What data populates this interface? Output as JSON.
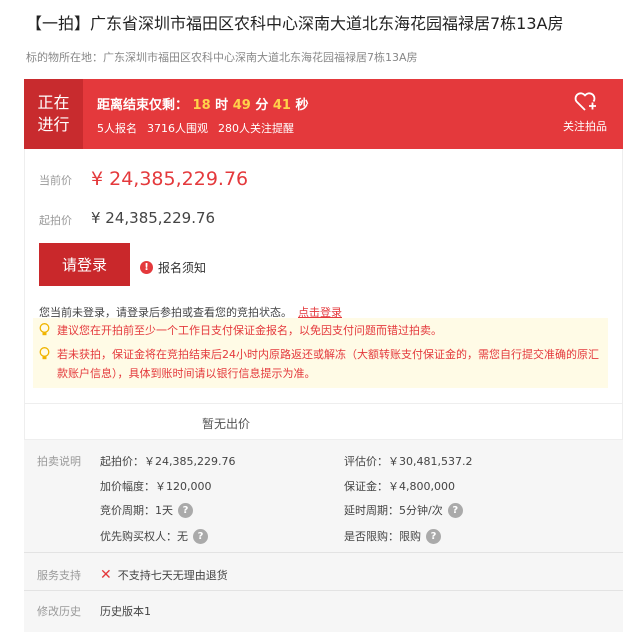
{
  "header": {
    "title": "【一拍】广东省深圳市福田区农科中心深南大道北东海花园福禄居7栋13A房",
    "location_label": "标的物所在地：",
    "location_value": "广东深圳市福田区农科中心深南大道北东海花园福禄居7栋13A房"
  },
  "banner": {
    "status_line1": "正在",
    "status_line2": "进行",
    "countdown_label": "距离结束仅剩：",
    "hours": "18",
    "hours_unit": "时",
    "minutes": "49",
    "minutes_unit": "分",
    "seconds": "41",
    "seconds_unit": "秒",
    "signups": "5人报名",
    "views": "3716人围观",
    "followers": "280人关注提醒",
    "follow_label": "关注拍品",
    "colors": {
      "banner": "#e4393c",
      "status_box": "#c82b2e",
      "countdown_numbers": "#ffd24a"
    }
  },
  "bid": {
    "current_label": "当前价",
    "current_price": "¥ 24,385,229.76",
    "start_label": "起拍价",
    "start_price": "¥ 24,385,229.76",
    "login_button": "请登录",
    "notice_link": "报名须知",
    "login_hint": "您当前未登录，请登录后参拍或查看您的竞拍状态。",
    "login_link": "点击登录",
    "tip1": "建议您在开拍前至少一个工作日支付保证金报名，以免因支付问题而错过拍卖。",
    "tip2": "若未获拍，保证金将在竞拍结束后24小时内原路返还或解冻（大额转账支付保证金的，需您自行提交准确的原汇款账户信息），具体到账时间请以银行信息提示为准。",
    "no_bid": "暂无出价"
  },
  "details": {
    "section_label": "拍卖说明",
    "start_price": "起拍价：￥24,385,229.76",
    "increment": "加价幅度：￥120,000",
    "cycle": "竞价周期：1天",
    "priority": "优先购买权人：无",
    "appraisal": "评估价：￥30,481,537.2",
    "deposit": "保证金：￥4,800,000",
    "delay": "延时周期：5分钟/次",
    "purchase_limit": "是否限购：限购",
    "service_label": "服务支持",
    "service_value": "不支持七天无理由退货",
    "history_label": "修改历史",
    "history_value": "历史版本1"
  }
}
